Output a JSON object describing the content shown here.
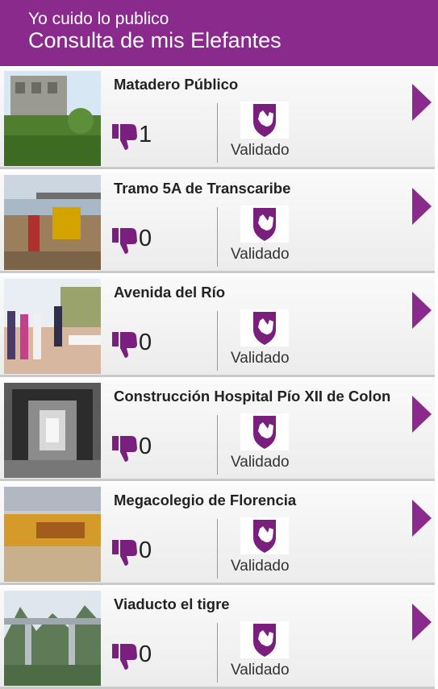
{
  "header": {
    "subtitle": "Yo cuido lo publico",
    "title": "Consulta de mis Elefantes"
  },
  "colors": {
    "brand": "#8a2a8c",
    "icon": "#7b1f7e"
  },
  "items": [
    {
      "name": "Matadero Público",
      "count": "1",
      "status": "Validado",
      "photo": "construction-site-photo"
    },
    {
      "name": "Tramo 5A de Transcaribe",
      "count": "0",
      "status": "Validado",
      "photo": "roadworks-photo"
    },
    {
      "name": "Avenida del Río",
      "count": "0",
      "status": "Validado",
      "photo": "riverside-avenue-photo"
    },
    {
      "name": "Construcción Hospital Pío XII de Colon",
      "count": "0",
      "status": "Validado",
      "photo": "hospital-corridor-photo"
    },
    {
      "name": "Megacolegio de Florencia",
      "count": "0",
      "status": "Validado",
      "photo": "school-building-photo"
    },
    {
      "name": "Viaducto el tigre",
      "count": "0",
      "status": "Validado",
      "photo": "viaduct-photo"
    }
  ]
}
